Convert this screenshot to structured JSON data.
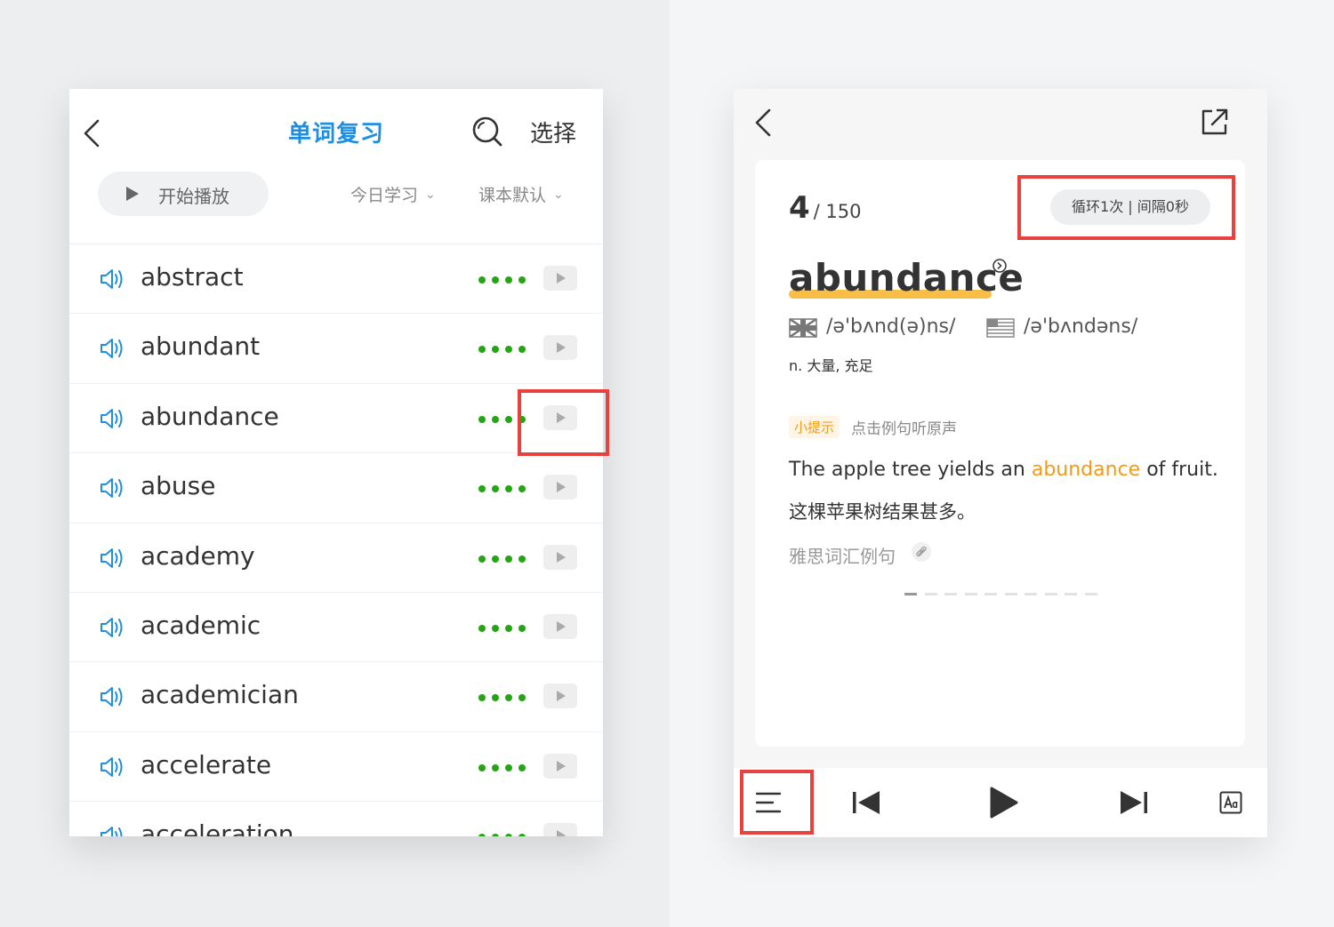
{
  "left_panel": {
    "title": "单词复习",
    "select_label": "选择",
    "play_label": "开始播放",
    "filter_1": "今日学习",
    "filter_2": "课本默认",
    "words": [
      {
        "word": "abstract"
      },
      {
        "word": "abundant"
      },
      {
        "word": "abundance"
      },
      {
        "word": "abuse"
      },
      {
        "word": "academy"
      },
      {
        "word": "academic"
      },
      {
        "word": "academician"
      },
      {
        "word": "accelerate"
      },
      {
        "word": "acceleration"
      }
    ],
    "dot_color": "#24a614"
  },
  "right_panel": {
    "current_index": "4",
    "total": "/ 150",
    "loop_setting": "循环1次 | 间隔0秒",
    "headword": "abundance",
    "uk_phonetic": "/ə'bʌnd(ə)ns/",
    "us_phonetic": "/ə'bʌndəns/",
    "definition": "n. 大量, 充足",
    "tip_badge": "小提示",
    "tip_text": "点击例句听原声",
    "example_en_before": "The apple tree yields an ",
    "example_en_highlight": "abundance",
    "example_en_after": " of fruit.",
    "example_zh": "这棵苹果树结果甚多。",
    "source": "雅思词汇例句",
    "page_count": 10,
    "active_page": 0,
    "accent_color": "#f29b1a"
  },
  "colors": {
    "title_blue": "#1f8ee0",
    "highlight_red": "#e8423f"
  }
}
